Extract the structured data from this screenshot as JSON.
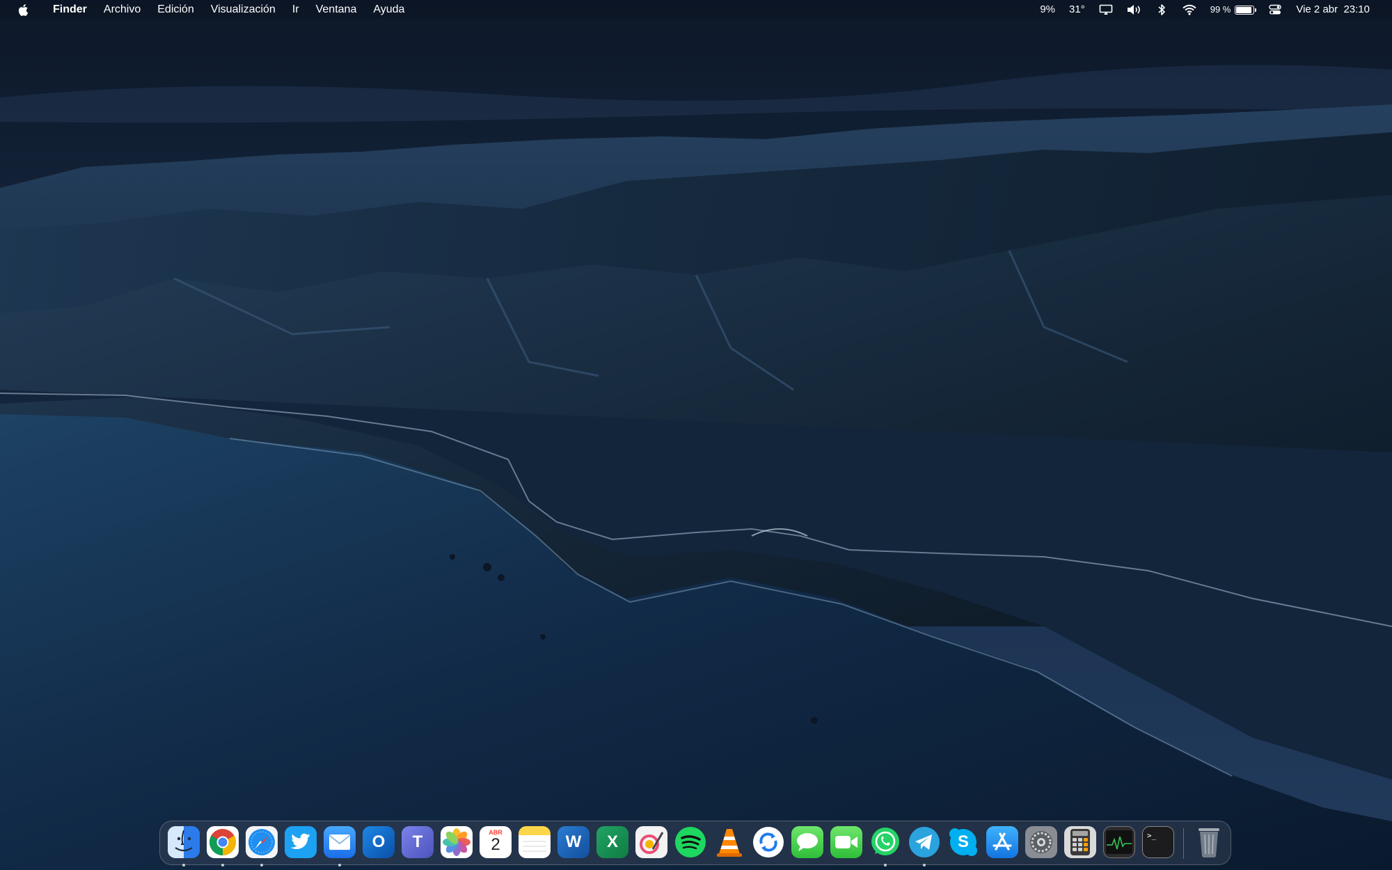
{
  "menubar": {
    "app_name": "Finder",
    "menus": [
      "Archivo",
      "Edición",
      "Visualización",
      "Ir",
      "Ventana",
      "Ayuda"
    ],
    "status": {
      "cpu": "9%",
      "temperature": "31°",
      "battery_text": "99 %",
      "battery_level": 0.99,
      "datetime": "Vie 2 abr  23:10"
    }
  },
  "dock": {
    "apps": [
      {
        "name": "Finder",
        "running": true
      },
      {
        "name": "Google Chrome",
        "running": true
      },
      {
        "name": "Safari",
        "running": true
      },
      {
        "name": "Twitter",
        "running": false
      },
      {
        "name": "Mail",
        "running": true
      },
      {
        "name": "Microsoft Outlook",
        "running": false
      },
      {
        "name": "Microsoft Teams",
        "running": false
      },
      {
        "name": "Fotos",
        "running": false
      },
      {
        "name": "Calendario",
        "running": false,
        "month": "ABR",
        "day": "2"
      },
      {
        "name": "Notas",
        "running": false
      },
      {
        "name": "Microsoft Word",
        "running": false
      },
      {
        "name": "Microsoft Excel",
        "running": false
      },
      {
        "name": "Pixelmator",
        "running": false
      },
      {
        "name": "Spotify",
        "running": false
      },
      {
        "name": "VLC",
        "running": false
      },
      {
        "name": "Sync",
        "running": false
      },
      {
        "name": "Mensajes",
        "running": false
      },
      {
        "name": "FaceTime",
        "running": false
      },
      {
        "name": "WhatsApp",
        "running": true
      },
      {
        "name": "Telegram",
        "running": true
      },
      {
        "name": "Skype",
        "running": false
      },
      {
        "name": "App Store",
        "running": false
      },
      {
        "name": "Preferencias del Sistema",
        "running": false
      },
      {
        "name": "Calculadora",
        "running": false
      },
      {
        "name": "Monitor de Actividad",
        "running": false
      },
      {
        "name": "Terminal",
        "running": false
      },
      {
        "name": "Papelera",
        "running": false
      }
    ],
    "glyphs": {
      "outlook": "O",
      "teams": "T",
      "word": "W",
      "excel": "X",
      "skype": "S",
      "terminal": ">_"
    }
  },
  "colors": {
    "menubar_bg": "#0c1422",
    "sky_top": "#0e1a2e",
    "sea": "#163456"
  }
}
